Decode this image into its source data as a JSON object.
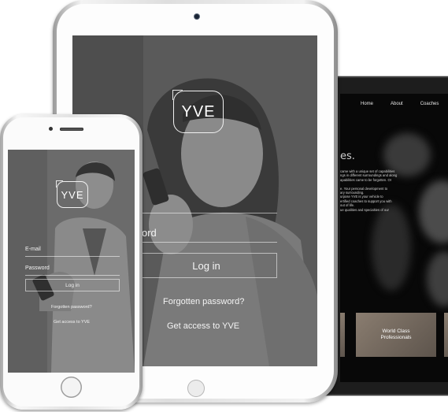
{
  "laptop": {
    "nav": [
      "Home",
      "About",
      "Coaches"
    ],
    "heading": "es.",
    "body_lines": [
      "came with a unique set of capabilities",
      "ngs in different surroundings and along",
      "apabilities came to be forgotten. Or",
      "",
      "e. Your personal development to",
      "ary surrounding.",
      "urpose YVE is your vehicle to",
      "ertified coaches to support you with",
      "out of life.",
      "ue qualities and specialties of our"
    ],
    "tile_label": "World Class\nProfessionals"
  },
  "tablet": {
    "logo": "YVE",
    "password_label": "ord",
    "login_button": "Log in",
    "forgot_link": "Forgotten password?",
    "access_link": "Get access to YVE"
  },
  "phone": {
    "logo": "YVE",
    "email_label": "E-mail",
    "password_label": "Password",
    "login_button": "Log in",
    "forgot_link": "Forgotten password?",
    "access_link": "Get access to YVE"
  },
  "colors": {
    "tablet_overlay": "#5e5e5e",
    "phone_overlay": "#6e6e6e",
    "laptop_bg": "#080808"
  }
}
